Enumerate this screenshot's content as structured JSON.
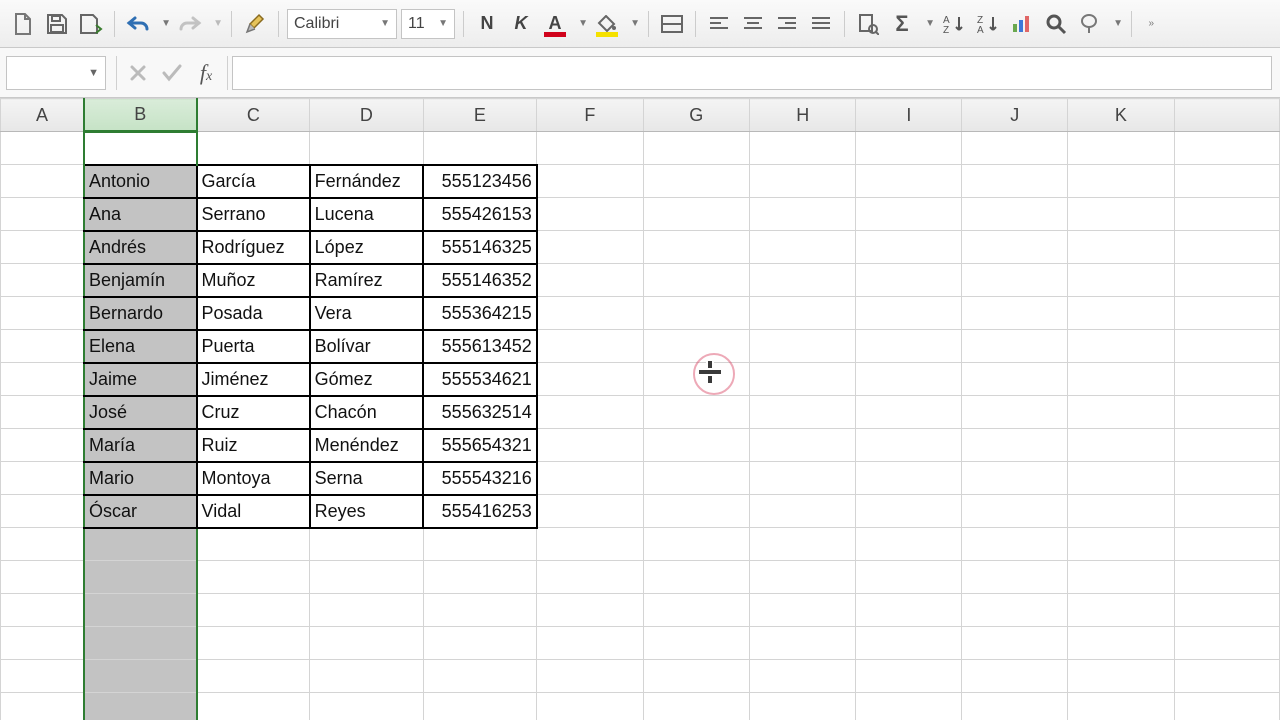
{
  "toolbar": {
    "font_name": "Calibri",
    "font_size": "11",
    "bold_glyph": "N",
    "italic_glyph": "K",
    "font_color": "#d0021b",
    "fill_color": "#f5e100"
  },
  "namebox": {
    "value": ""
  },
  "formula": {
    "value": ""
  },
  "columns": [
    "A",
    "B",
    "C",
    "D",
    "E",
    "F",
    "G",
    "H",
    "I",
    "J",
    "K"
  ],
  "selected_column": "B",
  "table": {
    "rows": [
      {
        "b": "Antonio",
        "c": "García",
        "d": "Fernández",
        "e": "555123456"
      },
      {
        "b": "Ana",
        "c": "Serrano",
        "d": "Lucena",
        "e": "555426153"
      },
      {
        "b": "Andrés",
        "c": "Rodríguez",
        "d": "López",
        "e": "555146325"
      },
      {
        "b": "Benjamín",
        "c": "Muñoz",
        "d": "Ramírez",
        "e": "555146352"
      },
      {
        "b": "Bernardo",
        "c": "Posada",
        "d": "Vera",
        "e": "555364215"
      },
      {
        "b": "Elena",
        "c": "Puerta",
        "d": "Bolívar",
        "e": "555613452"
      },
      {
        "b": "Jaime",
        "c": "Jiménez",
        "d": "Gómez",
        "e": "555534621"
      },
      {
        "b": "José",
        "c": "Cruz",
        "d": "Chacón",
        "e": "555632514"
      },
      {
        "b": "María",
        "c": "Ruiz",
        "d": "Menéndez",
        "e": "555654321"
      },
      {
        "b": "Mario",
        "c": "Montoya",
        "d": "Serna",
        "e": "555543216"
      },
      {
        "b": "Óscar",
        "c": "Vidal",
        "d": "Reyes",
        "e": "555416253"
      }
    ]
  }
}
